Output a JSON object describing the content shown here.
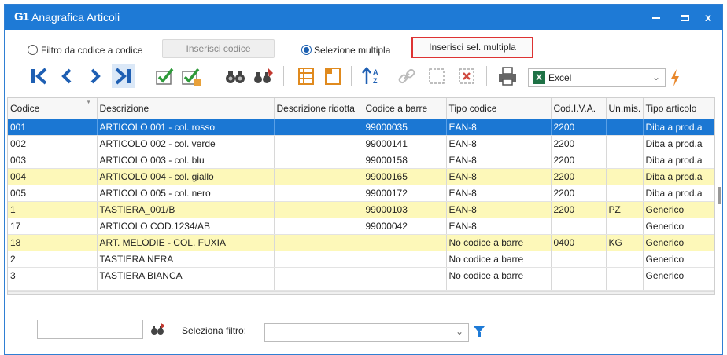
{
  "window": {
    "icon_text": "G1",
    "title": "Anagrafica Articoli",
    "minimize_icon": "minimize-icon",
    "maximize_icon": "maximize-icon",
    "close_glyph": "x"
  },
  "filter_row": {
    "radio_code_label": "Filtro da codice a codice",
    "insert_code_button": "Inserisci codice",
    "radio_multi_label": "Selezione multipla",
    "insert_multi_button": "Inserisci sel. multipla",
    "selected_mode": "Selezione multipla"
  },
  "toolbar": {
    "icons": [
      "first-record-icon",
      "previous-record-icon",
      "next-record-icon",
      "last-record-icon",
      "check-icon",
      "check-edit-icon",
      "binoculars-icon",
      "search-user-icon",
      "columns-icon",
      "page-corner-icon",
      "sort-az-icon",
      "link-icon",
      "select-frame-icon",
      "delete-icon",
      "print-icon",
      "excel-icon",
      "lightning-icon"
    ],
    "export_format": "Excel",
    "export_badge": "X",
    "accent_color": "#1e5fb3",
    "check_color": "#2e9a3a"
  },
  "grid": {
    "columns": [
      "Codice",
      "Descrizione",
      "Descrizione ridotta",
      "Codice a barre",
      "Tipo codice",
      "Cod.I.V.A.",
      "Un.mis.",
      "Tipo articolo"
    ],
    "rows": [
      {
        "codice": "001",
        "descrizione": "ARTICOLO 001 - col. rosso",
        "ridotta": "",
        "barre": "99000035",
        "tipo": "EAN-8",
        "iva": "2200",
        "um": "",
        "articolo": "Diba a prod.a",
        "style": "sel"
      },
      {
        "codice": "002",
        "descrizione": "ARTICOLO 002 - col. verde",
        "ridotta": "",
        "barre": "99000141",
        "tipo": "EAN-8",
        "iva": "2200",
        "um": "",
        "articolo": "Diba a prod.a",
        "style": ""
      },
      {
        "codice": "003",
        "descrizione": "ARTICOLO 003 - col. blu",
        "ridotta": "",
        "barre": "99000158",
        "tipo": "EAN-8",
        "iva": "2200",
        "um": "",
        "articolo": "Diba a prod.a",
        "style": ""
      },
      {
        "codice": "004",
        "descrizione": "ARTICOLO 004 - col. giallo",
        "ridotta": "",
        "barre": "99000165",
        "tipo": "EAN-8",
        "iva": "2200",
        "um": "",
        "articolo": "Diba a prod.a",
        "style": "yel"
      },
      {
        "codice": "005",
        "descrizione": "ARTICOLO 005 - col. nero",
        "ridotta": "",
        "barre": "99000172",
        "tipo": "EAN-8",
        "iva": "2200",
        "um": "",
        "articolo": "Diba a prod.a",
        "style": ""
      },
      {
        "codice": "1",
        "descrizione": "TASTIERA_001/B",
        "ridotta": "",
        "barre": "99000103",
        "tipo": "EAN-8",
        "iva": "2200",
        "um": "PZ",
        "articolo": "Generico",
        "style": "yel"
      },
      {
        "codice": "17",
        "descrizione": "ARTICOLO COD.1234/AB",
        "ridotta": "",
        "barre": "99000042",
        "tipo": "EAN-8",
        "iva": "",
        "um": "",
        "articolo": "Generico",
        "style": ""
      },
      {
        "codice": "18",
        "descrizione": "ART. MELODIE - COL. FUXIA",
        "ridotta": "",
        "barre": "",
        "tipo": "No codice a barre",
        "iva": "0400",
        "um": "KG",
        "articolo": "Generico",
        "style": "yel"
      },
      {
        "codice": "2",
        "descrizione": "TASTIERA NERA",
        "ridotta": "",
        "barre": "",
        "tipo": "No codice a barre",
        "iva": "",
        "um": "",
        "articolo": "Generico",
        "style": ""
      },
      {
        "codice": "3",
        "descrizione": "TASTIERA BIANCA",
        "ridotta": "",
        "barre": "",
        "tipo": "No codice a barre",
        "iva": "",
        "um": "",
        "articolo": "Generico",
        "style": ""
      }
    ],
    "selected_color": "#1b77d3",
    "highlight_color": "#fdf8b9"
  },
  "bottom": {
    "code_value": "",
    "filter_label": "Seleziona filtro:",
    "filter_value": ""
  }
}
